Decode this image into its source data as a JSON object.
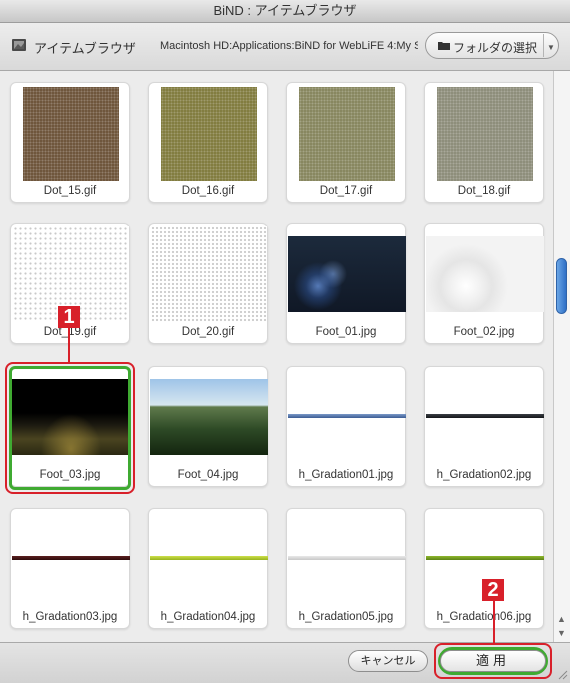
{
  "window": {
    "title": "BiND : アイテムブラウザ"
  },
  "toolbar": {
    "title": "アイテムブラウザ",
    "path": "Macintosh HD:Applications:BiND for WebLiFE 4:My So...",
    "folder_button_label": "フォルダの選択"
  },
  "items": [
    {
      "label": "Dot_15.gif"
    },
    {
      "label": "Dot_16.gif"
    },
    {
      "label": "Dot_17.gif"
    },
    {
      "label": "Dot_18.gif"
    },
    {
      "label": "Dot_19.gif"
    },
    {
      "label": "Dot_20.gif"
    },
    {
      "label": "Foot_01.jpg"
    },
    {
      "label": "Foot_02.jpg"
    },
    {
      "label": "Foot_03.jpg"
    },
    {
      "label": "Foot_04.jpg"
    },
    {
      "label": "h_Gradation01.jpg"
    },
    {
      "label": "h_Gradation02.jpg"
    },
    {
      "label": "h_Gradation03.jpg"
    },
    {
      "label": "h_Gradation04.jpg"
    },
    {
      "label": "h_Gradation05.jpg"
    },
    {
      "label": "h_Gradation06.jpg"
    }
  ],
  "selected_item": "Foot_03.jpg",
  "footer": {
    "cancel_label": "キャンセル",
    "apply_label": "適用"
  },
  "callouts": {
    "first": "1",
    "second": "2"
  },
  "colors": {
    "selection": "#3faa31",
    "callout": "#d8202a",
    "scroll_thumb": "#2e6fc6"
  }
}
